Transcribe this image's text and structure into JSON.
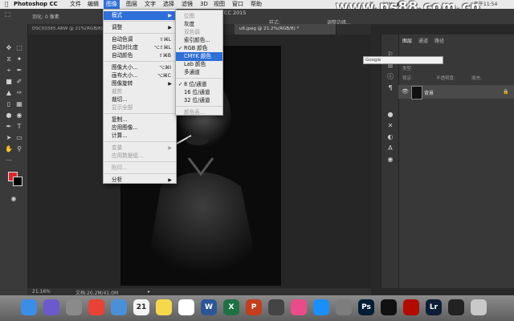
{
  "menubar": {
    "app": "Photoshop CC",
    "items": [
      "文件",
      "编辑",
      "图像",
      "图层",
      "文字",
      "选择",
      "滤镜",
      "3D",
      "视图",
      "窗口",
      "帮助"
    ],
    "active": "图像",
    "status": "29%",
    "clock": "下午11:54"
  },
  "watermark": "www.ps88.com.cn",
  "window_title": "Adobe Photoshop CC 2015",
  "options": {
    "feather_label": "羽化:",
    "feather_value": "0 像素",
    "style_label": "样式:",
    "refine_label": "调整边缘..."
  },
  "tabs": [
    {
      "label": "DSC00365.ARW @ 21%(RGB/8)",
      "active": false
    },
    {
      "label": "u6.jpeg @ 21.2%(RGB/8) *",
      "active": true
    }
  ],
  "status_bar": {
    "zoom": "21.16%",
    "doc": "文档:20.2M/41.0M"
  },
  "panel": {
    "tabs": [
      "图层",
      "通道",
      "路径"
    ],
    "kind_label": "类型",
    "opacity_label": "不透明度:",
    "fill_label": "填充:",
    "lock_label": "锁定:",
    "layer_name": "背景"
  },
  "google_bar": "Google",
  "image_menu": {
    "items": [
      {
        "label": "模式",
        "submenu": true,
        "highlight": true
      },
      {
        "sep": true
      },
      {
        "label": "调整",
        "submenu": true
      },
      {
        "sep": true
      },
      {
        "label": "自动色调",
        "shortcut": "⇧⌘L"
      },
      {
        "label": "自动对比度",
        "shortcut": "⌥⇧⌘L"
      },
      {
        "label": "自动颜色",
        "shortcut": "⇧⌘B"
      },
      {
        "sep": true
      },
      {
        "label": "图像大小...",
        "shortcut": "⌥⌘I"
      },
      {
        "label": "画布大小...",
        "shortcut": "⌥⌘C"
      },
      {
        "label": "图像旋转",
        "submenu": true
      },
      {
        "label": "裁剪",
        "disabled": true
      },
      {
        "label": "裁切..."
      },
      {
        "label": "显示全部",
        "disabled": true
      },
      {
        "sep": true
      },
      {
        "label": "复制..."
      },
      {
        "label": "应用图像..."
      },
      {
        "label": "计算..."
      },
      {
        "sep": true
      },
      {
        "label": "变量",
        "submenu": true,
        "disabled": true
      },
      {
        "label": "应用数据组...",
        "disabled": true
      },
      {
        "sep": true
      },
      {
        "label": "陷印...",
        "disabled": true
      },
      {
        "sep": true
      },
      {
        "label": "分析",
        "submenu": true
      }
    ]
  },
  "mode_menu": {
    "items": [
      {
        "label": "位图",
        "disabled": true
      },
      {
        "label": "灰度"
      },
      {
        "label": "双色调",
        "disabled": true
      },
      {
        "label": "索引颜色..."
      },
      {
        "label": "RGB 颜色",
        "checked": true
      },
      {
        "label": "CMYK 颜色",
        "highlight": true
      },
      {
        "label": "Lab 颜色"
      },
      {
        "label": "多通道"
      },
      {
        "sep": true
      },
      {
        "label": "8 位/通道",
        "checked": true
      },
      {
        "label": "16 位/通道"
      },
      {
        "label": "32 位/通道"
      },
      {
        "sep": true
      },
      {
        "label": "颜色表...",
        "disabled": true
      }
    ]
  },
  "dock_icons": [
    "finder-icon",
    "siri-icon",
    "launchpad-icon",
    "chrome-icon",
    "mail-icon",
    "calendar-icon",
    "notes-icon",
    "photos-icon",
    "word-icon",
    "excel-icon",
    "powerpoint-icon",
    "dvd-icon",
    "itunes-icon",
    "appstore-icon",
    "system-preferences-icon",
    "photoshop-icon",
    "terminal-icon",
    "acrobat-icon",
    "lightroom-icon",
    "screen-icon",
    "trash-icon"
  ],
  "dock_labels": {
    "calendar": "21",
    "word": "W",
    "excel": "X",
    "powerpoint": "P",
    "photoshop": "Ps",
    "lightroom": "Lr"
  },
  "colors": {
    "menu_highlight": "#2f6fd8",
    "watermark": "#ffffff",
    "foreground_swatch": "#e0262d"
  }
}
